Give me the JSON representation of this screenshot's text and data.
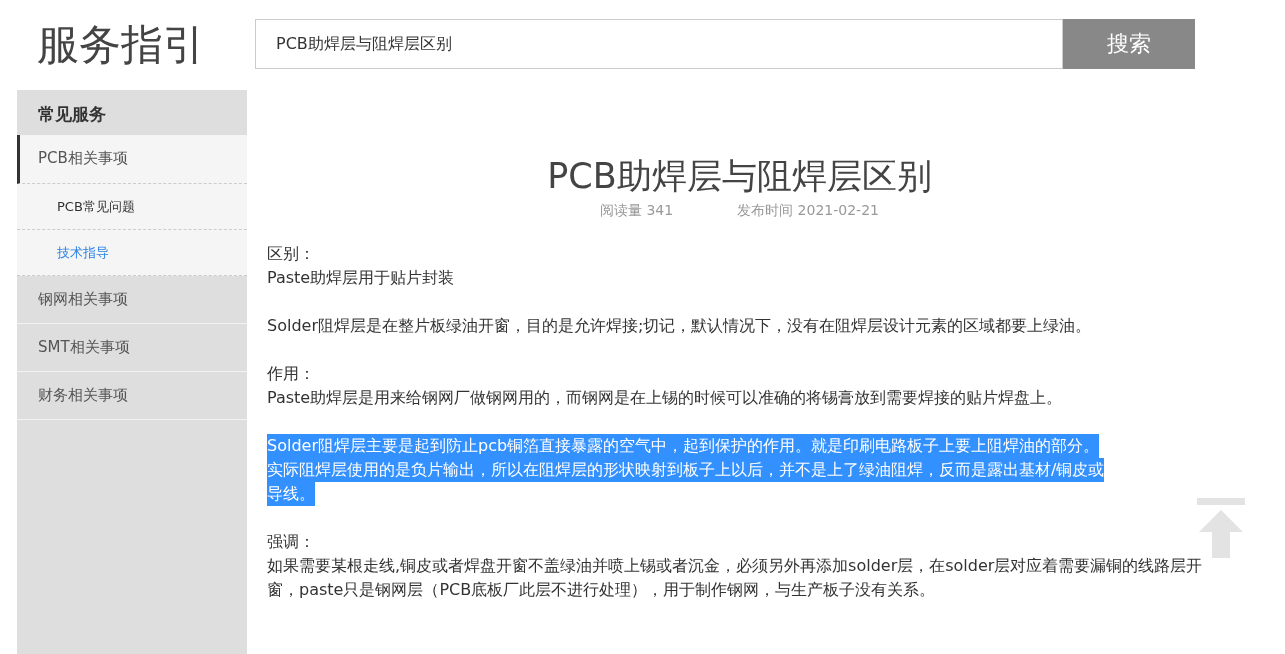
{
  "logo": "服务指引",
  "search": {
    "value": "PCB助焊层与阻焊层区别",
    "button": "搜索"
  },
  "sidebar": {
    "heading": "常见服务",
    "items": [
      {
        "label": "PCB相关事项",
        "selected": false,
        "expanded": true,
        "children": [
          {
            "label": "PCB常见问题",
            "selected": false
          },
          {
            "label": "技术指导",
            "selected": true
          }
        ]
      },
      {
        "label": "钢网相关事项",
        "selected": false,
        "expanded": false
      },
      {
        "label": "SMT相关事项",
        "selected": false,
        "expanded": false
      },
      {
        "label": "财务相关事项",
        "selected": false,
        "expanded": false
      }
    ]
  },
  "article": {
    "title": "PCB助焊层与阻焊层区别",
    "reads": "阅读量 341",
    "published": "发布时间 2021-02-21",
    "blocks": [
      {
        "highlighted": false,
        "lines": [
          "区别：",
          "Paste助焊层用于贴片封装"
        ]
      },
      {
        "highlighted": false,
        "lines": [
          "Solder阻焊层是在整片板绿油开窗，目的是允许焊接;切记，默认情况下，没有在阻焊层设计元素的区域都要上绿油。"
        ]
      },
      {
        "highlighted": false,
        "lines": [
          "作用：",
          "Paste助焊层是用来给钢网厂做钢网用的，而钢网是在上锡的时候可以准确的将锡膏放到需要焊接的贴片焊盘上。"
        ]
      },
      {
        "highlighted": true,
        "lines": [
          "Solder阻焊层主要是起到防止pcb铜箔直接暴露的空气中，起到保护的作用。就是印刷电路板子上要上阻焊油的部分。",
          "实际阻焊层使用的是负片输出，所以在阻焊层的形状映射到板子上以后，并不是上了绿油阻焊，反而是露出基材/铜皮或",
          "导线。"
        ]
      },
      {
        "highlighted": false,
        "lines": [
          "强调：",
          "如果需要某根走线,铜皮或者焊盘开窗不盖绿油并喷上锡或者沉金，必须另外再添加solder层，在solder层对应着需要漏铜的线路层开窗，paste只是钢网层（PCB底板厂此层不进行处理），用于制作钢网，与生产板子没有关系。"
        ]
      }
    ]
  }
}
